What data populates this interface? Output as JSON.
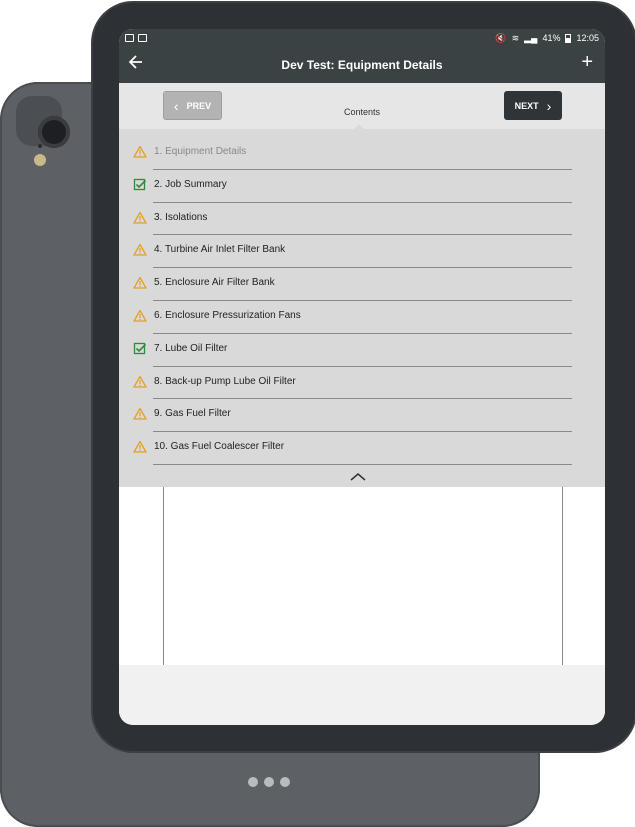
{
  "status_bar": {
    "battery": "41%",
    "time": "12:05"
  },
  "app_bar": {
    "back_icon": "arrow-left-icon",
    "title": "Dev Test:  Equipment Details",
    "add_icon": "plus-icon"
  },
  "nav": {
    "prev_label": "PREV",
    "next_label": "NEXT",
    "contents_label": "Contents"
  },
  "toc": {
    "items": [
      {
        "label": "1. Equipment Details",
        "status": "warning",
        "current": true
      },
      {
        "label": "2. Job Summary",
        "status": "complete"
      },
      {
        "label": "3. Isolations",
        "status": "warning"
      },
      {
        "label": "4. Turbine Air Inlet Filter Bank",
        "status": "warning"
      },
      {
        "label": "5. Enclosure Air Filter Bank",
        "status": "warning"
      },
      {
        "label": "6. Enclosure Pressurization Fans",
        "status": "warning"
      },
      {
        "label": "7. Lube Oil Filter",
        "status": "complete"
      },
      {
        "label": "8. Back-up Pump Lube Oil Filter",
        "status": "warning"
      },
      {
        "label": "9. Gas Fuel Filter",
        "status": "warning"
      },
      {
        "label": "10. Gas Fuel Coalescer Filter",
        "status": "warning"
      }
    ]
  },
  "colors": {
    "app_bar": "#3a4243",
    "warning": "#e6a020",
    "complete": "#2e8b3a",
    "toc_bg": "#d9d9d9"
  }
}
